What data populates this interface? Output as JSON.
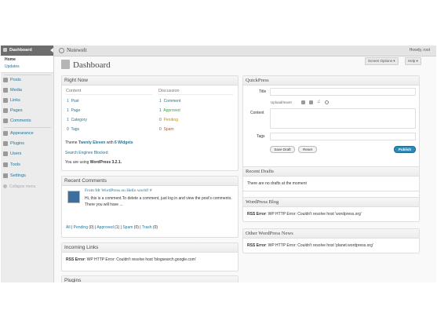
{
  "admin_bar": {
    "site_title": "Notewelt",
    "howdy": "Howdy, root"
  },
  "sidebar": {
    "dashboard_label": "Dashboard",
    "submenu": [
      "Home",
      "Updates"
    ],
    "items": [
      "Posts",
      "Media",
      "Links",
      "Pages",
      "Comments",
      "Appearance",
      "Plugins",
      "Users",
      "Tools",
      "Settings"
    ],
    "collapse_label": "Collapse menu"
  },
  "header": {
    "title": "Dashboard",
    "screen_options": "Screen Options ▾",
    "help": "Help ▾"
  },
  "right_now": {
    "title": "Right Now",
    "content_heading": "Content",
    "discussion_heading": "Discussion",
    "content": [
      {
        "count": "1",
        "label": "Post"
      },
      {
        "count": "1",
        "label": "Page"
      },
      {
        "count": "1",
        "label": "Category"
      },
      {
        "count": "0",
        "label": "Tags"
      }
    ],
    "discussion": [
      {
        "count": "1",
        "label": "Comment"
      },
      {
        "count": "1",
        "label": "Approved"
      },
      {
        "count": "0",
        "label": "Pending"
      },
      {
        "count": "0",
        "label": "Spam"
      }
    ],
    "theme_prefix": "Theme",
    "theme_name": "Twenty Eleven",
    "theme_with": "with",
    "widgets": "6 Widgets",
    "search_engines": "Search Engines Blocked",
    "version_prefix": "You are using",
    "version": "WordPress 3.2.1."
  },
  "recent_comments": {
    "title": "Recent Comments",
    "from_line": "From Mr WordPress on Hello world! #",
    "body": "Hi, this is a comment.To delete a comment, just log in and view the post's comments. There you will have ...",
    "filters": [
      {
        "label": "All",
        "count": ""
      },
      {
        "label": "Pending",
        "count": "(0)"
      },
      {
        "label": "Approved",
        "count": "(1)"
      },
      {
        "label": "Spam",
        "count": "(0)"
      },
      {
        "label": "Trash",
        "count": "(0)"
      }
    ]
  },
  "incoming_links": {
    "title": "Incoming Links",
    "error_label": "RSS Error",
    "error_text": ": WP HTTP Error: Couldn't resolve host 'blogsearch.google.com'"
  },
  "plugins": {
    "title": "Plugins"
  },
  "quickpress": {
    "title": "QuickPress",
    "title_label": "Title",
    "upload_label": "Upload/Insert",
    "content_label": "Content",
    "tags_label": "Tags",
    "save_draft": "Save Draft",
    "reset": "Reset",
    "publish": "Publish"
  },
  "recent_drafts": {
    "title": "Recent Drafts",
    "text": "There are no drafts at the moment"
  },
  "wp_blog": {
    "title": "WordPress Blog",
    "error_label": "RSS Error",
    "error_text": ": WP HTTP Error: Couldn't resolve host 'wordpress.org'"
  },
  "other_news": {
    "title": "Other WordPress News",
    "error_label": "RSS Error",
    "error_text": ": WP HTTP Error: Couldn't resolve host 'planet.wordpress.org'"
  }
}
